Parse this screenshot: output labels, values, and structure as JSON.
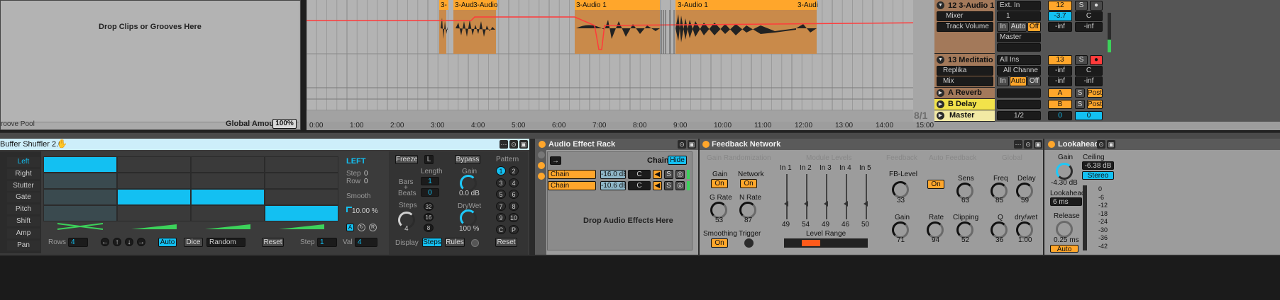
{
  "groove_pool": {
    "drop_text": "Drop Clips or Grooves Here",
    "title": "roove Pool",
    "global_amount_label": "Global Amount",
    "global_amount_value": "100%"
  },
  "arrangement": {
    "clips": [
      "3-",
      "3-Aud",
      "3-Audio",
      "3-Audio 1",
      "3-Audio 1",
      "3-Audi"
    ],
    "ruler": [
      "0:00",
      "1:00",
      "2:00",
      "3:00",
      "4:00",
      "5:00",
      "6:00",
      "7:00",
      "8:00",
      "9:00",
      "10:00",
      "11:00",
      "12:00",
      "13:00",
      "14:00",
      "15:00"
    ],
    "meter": "8/1"
  },
  "tracks": [
    {
      "name": "12 3-Audio 1",
      "input": "Ext. In",
      "channel": "1",
      "num": "12",
      "s": "S",
      "volume": "-3.7",
      "pan": "C",
      "device": "Mixer",
      "param": "Track Volume",
      "mon_in": "In",
      "mon_auto": "Auto",
      "mon_off": "Off",
      "out": "Master",
      "inf1": "-inf",
      "inf2": "-inf"
    },
    {
      "name": "13 Meditatio",
      "input": "All Ins",
      "channel": "All Channe",
      "num": "13",
      "s": "S",
      "volume": "-inf",
      "pan": "C",
      "device": "Replika",
      "param": "Mix",
      "mon_in": "In",
      "mon_auto": "Auto",
      "mon_off": "Off",
      "inf1": "-inf",
      "inf2": "-inf"
    },
    {
      "name": "A Reverb",
      "letter": "A",
      "s": "S",
      "post": "Post"
    },
    {
      "name": "B Delay",
      "letter": "B",
      "s": "S",
      "post": "Post"
    },
    {
      "name": "Master",
      "sel": "1/2",
      "v1": "0",
      "v2": "0"
    }
  ],
  "buffer": {
    "title": "Buffer Shuffler 2.0",
    "tabs": [
      "Left",
      "Right",
      "Stutter",
      "Gate",
      "Pitch",
      "Shift",
      "Amp",
      "Pan"
    ],
    "side_title": "LEFT",
    "step_label": "Step",
    "step_val": "0",
    "row_label": "Row",
    "row_val": "0",
    "smooth_label": "Smooth",
    "smooth_val": "10.00 %",
    "btn_a": "A",
    "btn_r": "R",
    "rows_label": "Rows",
    "rows_val": "4",
    "auto": "Auto",
    "dice": "Dice",
    "random": "Random",
    "reset": "Reset",
    "step2_label": "Step",
    "step2_val": "1",
    "val_label": "Val",
    "val_val": "4",
    "freeze": "Freeze",
    "l": "L",
    "bypass": "Bypass",
    "length": "Length",
    "len1": "1",
    "len0": "0",
    "bars": "Bars",
    "plus": "+",
    "beats": "Beats",
    "steps": "Steps",
    "steps_val": "4",
    "steps_opts": [
      "32",
      "16",
      "8"
    ],
    "gain": "Gain",
    "gain_val": "0.0 dB",
    "drywet": "DryWet",
    "drywet_val": "100 %",
    "pattern": "Pattern",
    "patterns": [
      "1",
      "2",
      "3",
      "4",
      "5",
      "6",
      "7",
      "8",
      "9",
      "10",
      "C",
      "P"
    ],
    "display": "Display",
    "disp_steps": "Steps",
    "disp_rules": "Rules",
    "reset2": "Reset"
  },
  "rack": {
    "title": "Audio Effect Rack",
    "chain_btn": "Chain",
    "hide_btn": "Hide",
    "chains": [
      {
        "name": "Chain",
        "db": "-16.0 dB",
        "pan": "C",
        "s": "S"
      },
      {
        "name": "Chain",
        "db": "-10.6 dB",
        "pan": "C",
        "s": "S"
      }
    ],
    "drop": "Drop Audio Effects Here"
  },
  "feedback": {
    "title": "Feedback Network",
    "sec1": "Gain Randomization",
    "gain": "Gain",
    "network": "Network",
    "on": "On",
    "grate": "G Rate",
    "grate_val": "53",
    "nrate": "N Rate",
    "nrate_val": "87",
    "smoothing": "Smoothing",
    "trigger": "Trigger",
    "sec2": "Module Levels",
    "levels": [
      {
        "n": "In 1",
        "v": "49"
      },
      {
        "n": "In 2",
        "v": "54"
      },
      {
        "n": "In 3",
        "v": "49"
      },
      {
        "n": "In 4",
        "v": "46"
      },
      {
        "n": "In 5",
        "v": "50"
      }
    ],
    "level_range": "Level Range",
    "sec3": "Feedback",
    "fb": "FB-Level",
    "fb_val": "33",
    "gain2": "Gain",
    "gain2_val": "71",
    "sec4": "Auto Feedback",
    "sens": "Sens",
    "sens_val": "63",
    "rate": "Rate",
    "rate_val": "94",
    "clipping": "Clipping",
    "clipping_val": "52",
    "sec5": "Global",
    "freq": "Freq",
    "freq_val": "85",
    "delay": "Delay",
    "delay_val": "59",
    "q": "Q",
    "q_val": "36",
    "drywet": "dry/wet",
    "drywet_val": "1.00"
  },
  "lookahead": {
    "title": "Lookahead",
    "gain": "Gain",
    "gain_val": "-4.30 dB",
    "ceiling": "Ceiling",
    "ceiling_val": "-6.38 dB",
    "stereo": "Stereo",
    "lookahead": "Lookahead",
    "lookahead_val": "6 ms",
    "release": "Release",
    "release_val": "0.25 ms",
    "auto": "Auto",
    "scale": [
      "0",
      "-6",
      "-12",
      "-18",
      "-24",
      "-30",
      "-36",
      "-42"
    ]
  },
  "colors": {
    "orange": "#ffa62b",
    "blue": "#13c0f2",
    "yellow": "#f2e24a"
  }
}
